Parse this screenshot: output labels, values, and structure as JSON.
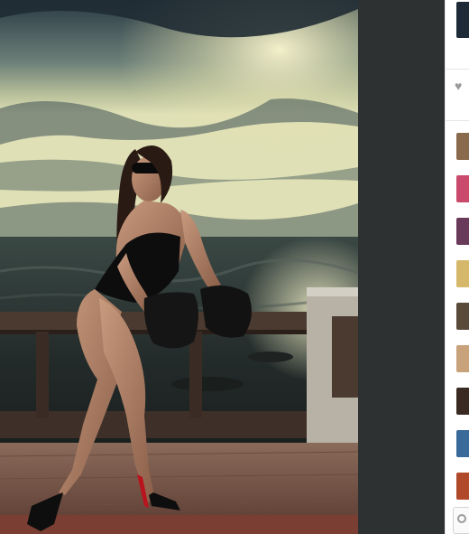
{
  "photo": {
    "alt": ""
  },
  "sidebar": {
    "like_icon": "heart-icon",
    "avatars": [
      {
        "color": "#8a6a4c"
      },
      {
        "color": "#c94a6a"
      },
      {
        "color": "#6a3a5a"
      },
      {
        "color": "#d6b86a"
      },
      {
        "color": "#5a4a3a"
      },
      {
        "color": "#c8a27a"
      },
      {
        "color": "#3a2a22"
      },
      {
        "color": "#3a6a9a"
      },
      {
        "color": "#b04a2a"
      }
    ]
  },
  "colors": {
    "gutter": "#2e3132",
    "sidebar_bg": "#ffffff"
  }
}
